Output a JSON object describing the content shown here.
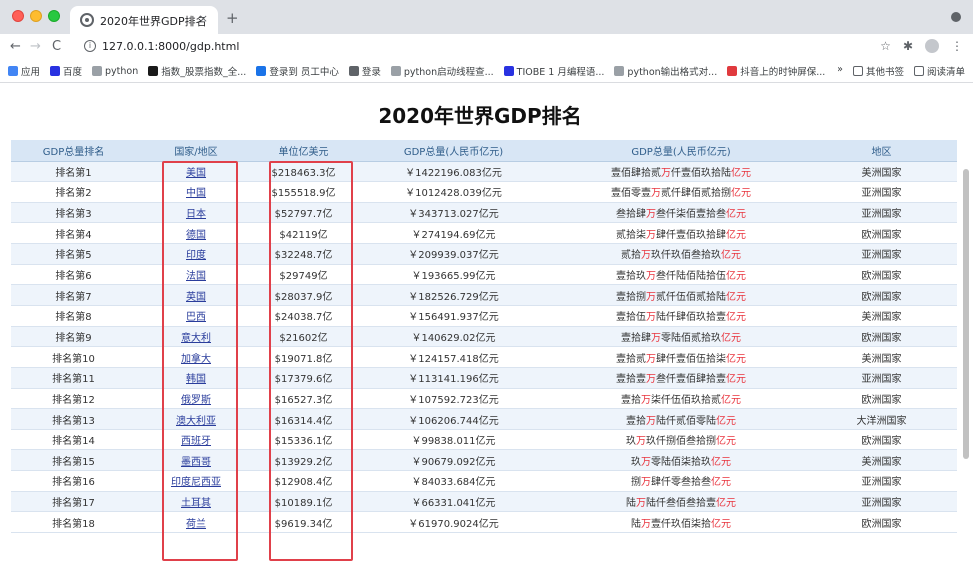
{
  "browser": {
    "tab_title": "2020年世界GDP排名",
    "tab_close": "×",
    "new_tab": "+",
    "url": "127.0.0.1:8000/gdp.html",
    "nav_back": "←",
    "nav_forward": "→",
    "nav_reload": "C",
    "info_icon": "i",
    "star_icon": "☆",
    "extension_icon": "✱",
    "menu_icon": "⋮",
    "bookmarks": [
      {
        "label": "应用",
        "color": "#4285f4"
      },
      {
        "label": "百度",
        "color": "#2932e1"
      },
      {
        "label": "python",
        "color": "#9aa0a6"
      },
      {
        "label": "指数_股票指数_全...",
        "color": "#1a1a1a"
      },
      {
        "label": "登录到 员工中心",
        "color": "#1a73e8"
      },
      {
        "label": "登录",
        "color": "#5f6368"
      },
      {
        "label": "python启动线程查...",
        "color": "#9aa0a6"
      },
      {
        "label": "TIOBE 1 月编程语...",
        "color": "#2932e1"
      },
      {
        "label": "python输出格式对...",
        "color": "#9aa0a6"
      },
      {
        "label": "抖音上的时钟屏保...",
        "color": "#e03a3e"
      }
    ],
    "bookmarks_more": "»",
    "other_bookmarks": "其他书签",
    "reading_list": "阅读清单"
  },
  "page": {
    "title": "2020年世界GDP排名",
    "columns": [
      "GDP总量排名",
      "国家/地区",
      "单位亿美元",
      "GDP总量(人民币亿元)",
      "GDP总量(人民币亿元)",
      "地区"
    ],
    "rows": [
      {
        "rank": "排名第1",
        "country": "美国",
        "usd": "$218463.3亿",
        "rmb": "￥1422196.083亿元",
        "cn_pre": "壹佰肆拾贰",
        "cn_mid": "仟壹佰玖拾陆",
        "region": "美洲国家"
      },
      {
        "rank": "排名第2",
        "country": "中国",
        "usd": "$155518.9亿",
        "rmb": "￥1012428.039亿元",
        "cn_pre": "壹佰零壹",
        "cn_mid": "贰仟肆佰贰拾捌",
        "region": "亚洲国家"
      },
      {
        "rank": "排名第3",
        "country": "日本",
        "usd": "$52797.7亿",
        "rmb": "￥343713.027亿元",
        "cn_pre": "叁拾肆",
        "cn_mid": "叁仟柒佰壹拾叁",
        "region": "亚洲国家"
      },
      {
        "rank": "排名第4",
        "country": "德国",
        "usd": "$42119亿",
        "rmb": "￥274194.69亿元",
        "cn_pre": "贰拾柒",
        "cn_mid": "肆仟壹佰玖拾肆",
        "region": "欧洲国家"
      },
      {
        "rank": "排名第5",
        "country": "印度",
        "usd": "$32248.7亿",
        "rmb": "￥209939.037亿元",
        "cn_pre": "贰拾",
        "cn_mid": "玖仟玖佰叁拾玖",
        "region": "亚洲国家"
      },
      {
        "rank": "排名第6",
        "country": "法国",
        "usd": "$29749亿",
        "rmb": "￥193665.99亿元",
        "cn_pre": "壹拾玖",
        "cn_mid": "叁仟陆佰陆拾伍",
        "region": "欧洲国家"
      },
      {
        "rank": "排名第7",
        "country": "英国",
        "usd": "$28037.9亿",
        "rmb": "￥182526.729亿元",
        "cn_pre": "壹拾捌",
        "cn_mid": "贰仟伍佰贰拾陆",
        "region": "欧洲国家"
      },
      {
        "rank": "排名第8",
        "country": "巴西",
        "usd": "$24038.7亿",
        "rmb": "￥156491.937亿元",
        "cn_pre": "壹拾伍",
        "cn_mid": "陆仟肆佰玖拾壹",
        "region": "美洲国家"
      },
      {
        "rank": "排名第9",
        "country": "意大利",
        "usd": "$21602亿",
        "rmb": "￥140629.02亿元",
        "cn_pre": "壹拾肆",
        "cn_mid": "零陆佰贰拾玖",
        "region": "欧洲国家"
      },
      {
        "rank": "排名第10",
        "country": "加拿大",
        "usd": "$19071.8亿",
        "rmb": "￥124157.418亿元",
        "cn_pre": "壹拾贰",
        "cn_mid": "肆仟壹佰伍拾柒",
        "region": "美洲国家"
      },
      {
        "rank": "排名第11",
        "country": "韩国",
        "usd": "$17379.6亿",
        "rmb": "￥113141.196亿元",
        "cn_pre": "壹拾壹",
        "cn_mid": "叁仟壹佰肆拾壹",
        "region": "亚洲国家"
      },
      {
        "rank": "排名第12",
        "country": "俄罗斯",
        "usd": "$16527.3亿",
        "rmb": "￥107592.723亿元",
        "cn_pre": "壹拾",
        "cn_mid": "柒仟伍佰玖拾贰",
        "region": "欧洲国家"
      },
      {
        "rank": "排名第13",
        "country": "澳大利亚",
        "usd": "$16314.4亿",
        "rmb": "￥106206.744亿元",
        "cn_pre": "壹拾",
        "cn_mid": "陆仟贰佰零陆",
        "region": "大洋洲国家"
      },
      {
        "rank": "排名第14",
        "country": "西班牙",
        "usd": "$15336.1亿",
        "rmb": "￥99838.011亿元",
        "cn_pre": "玖",
        "cn_mid": "玖仟捌佰叁拾捌",
        "region": "欧洲国家"
      },
      {
        "rank": "排名第15",
        "country": "墨西哥",
        "usd": "$13929.2亿",
        "rmb": "￥90679.092亿元",
        "cn_pre": "玖",
        "cn_mid": "零陆佰柒拾玖",
        "region": "美洲国家"
      },
      {
        "rank": "排名第16",
        "country": "印度尼西亚",
        "usd": "$12908.4亿",
        "rmb": "￥84033.684亿元",
        "cn_pre": "捌",
        "cn_mid": "肆仟零叁拾叁",
        "region": "亚洲国家"
      },
      {
        "rank": "排名第17",
        "country": "土耳其",
        "usd": "$10189.1亿",
        "rmb": "￥66331.041亿元",
        "cn_pre": "陆",
        "cn_mid": "陆仟叁佰叁拾壹",
        "region": "亚洲国家"
      },
      {
        "rank": "排名第18",
        "country": "荷兰",
        "usd": "$9619.34亿",
        "rmb": "￥61970.9024亿元",
        "cn_pre": "陆",
        "cn_mid": "壹仟玖佰柒拾",
        "region": "欧洲国家"
      }
    ],
    "wan": "万",
    "yiyuan": "亿元"
  }
}
